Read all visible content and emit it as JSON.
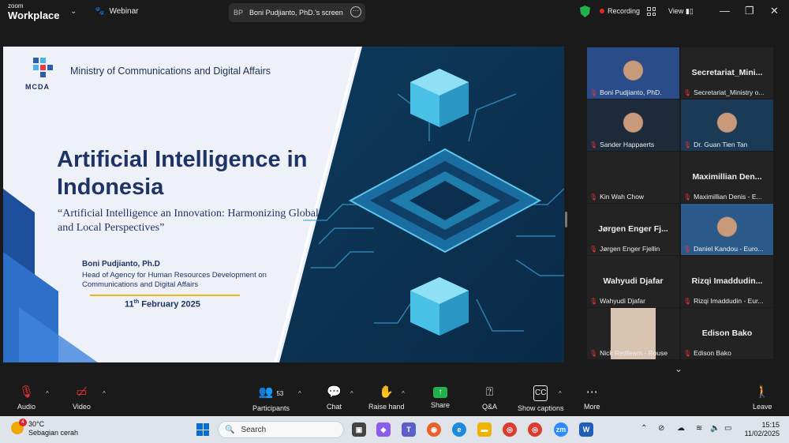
{
  "topbar": {
    "brand_small": "zoom",
    "brand_big": "Workplace",
    "webinar_label": "Webinar",
    "share_initials": "BP",
    "share_label": "Boni Pudjianto, PhD.'s screen",
    "recording_label": "Recording",
    "view_label": "View"
  },
  "slide": {
    "org": "Ministry of Communications and Digital Affairs",
    "logo_text": "MCDA",
    "title": "Artificial Intelligence in Indonesia",
    "subtitle": "“Artificial Intelligence an Innovation: Harmonizing Global and Local Perspectives”",
    "author": "Boni Pudjianto, Ph.D",
    "role": "Head of Agency for Human Resources Development on Communications and Digital Affairs",
    "date_day": "11",
    "date_suffix": "th",
    "date_rest": " February 2025"
  },
  "gallery": {
    "tiles": [
      {
        "name": "Boni Pudjianto, PhD.",
        "big": "",
        "video": true
      },
      {
        "name": "Secretariat_Ministry o...",
        "big": "Secretariat_Mini...",
        "video": false
      },
      {
        "name": "Sander Happaerts",
        "big": "",
        "video": true
      },
      {
        "name": "Dr. Guan Tien Tan",
        "big": "",
        "video": true
      },
      {
        "name": "Kin Wah Chow",
        "big": "",
        "video": false
      },
      {
        "name": "Maximillian Denis - E...",
        "big": "Maximillian  Den...",
        "video": false
      },
      {
        "name": "Jørgen Enger Fjellin",
        "big": "Jørgen  Enger  Fj...",
        "video": false
      },
      {
        "name": "Daniel Kandou - Euro...",
        "big": "",
        "video": true
      },
      {
        "name": "Wahyudi Djafar",
        "big": "Wahyudi  Djafar",
        "video": false
      },
      {
        "name": "Rizqi Imaddudin - Eur...",
        "big": "Rizqi  Imaddudin...",
        "video": false
      },
      {
        "name": "Nick Redfearn - Rouse",
        "big": "",
        "video": true
      },
      {
        "name": "Edison Bako",
        "big": "Edison  Bako",
        "video": false
      }
    ]
  },
  "toolbar": {
    "audio": "Audio",
    "video": "Video",
    "participants": "Participants",
    "participants_count": "53",
    "chat": "Chat",
    "raise_hand": "Raise hand",
    "share": "Share",
    "qa": "Q&A",
    "captions": "Show captions",
    "more": "More",
    "leave": "Leave"
  },
  "taskbar": {
    "temp": "30°C",
    "weather": "Sebagian cerah",
    "weather_badge": "4",
    "search_placeholder": "Search",
    "time": "15:15",
    "date": "11/02/2025"
  },
  "colors": {
    "accent_green": "#22b14c",
    "slide_navy": "#1e3466",
    "record_red": "#e02828"
  }
}
